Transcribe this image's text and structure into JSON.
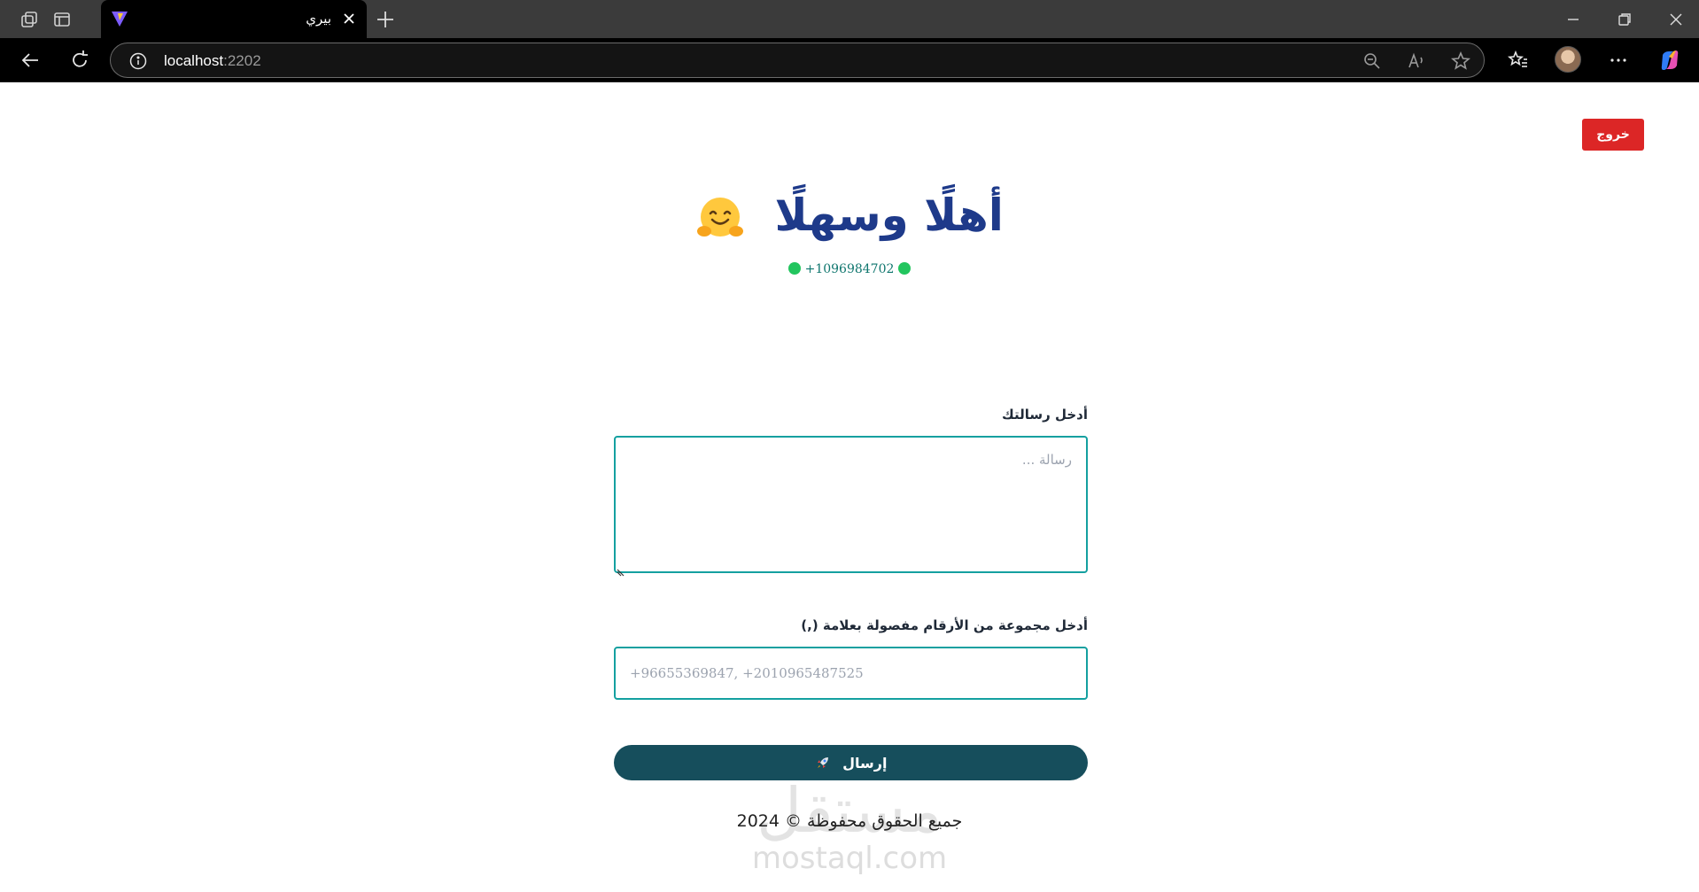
{
  "browser": {
    "tab_title": "بيري",
    "address_host": "localhost",
    "address_port": ":2202"
  },
  "header": {
    "logout_label": "خروج"
  },
  "hero": {
    "title": "أهلًا وسهلًا",
    "phone": "+1096984702"
  },
  "form": {
    "message_label": "أدخل رسالتك",
    "message_placeholder": "رسالة ...",
    "numbers_label": "أدخل مجموعة من الأرقام مفصولة بعلامة (,)",
    "numbers_placeholder": "+96655369847, +2010965487525",
    "send_label": "إرسال"
  },
  "footer": {
    "copyright": "جميع الحقوق محفوظة © 2024",
    "watermark_ar": "مستقل",
    "watermark_en": "mostaql.com"
  },
  "colors": {
    "accent_heading": "#1e3a8a",
    "logout": "#dc2626",
    "send": "#164e5c",
    "input_border": "#14a0a0",
    "status_dot": "#22c55e"
  }
}
